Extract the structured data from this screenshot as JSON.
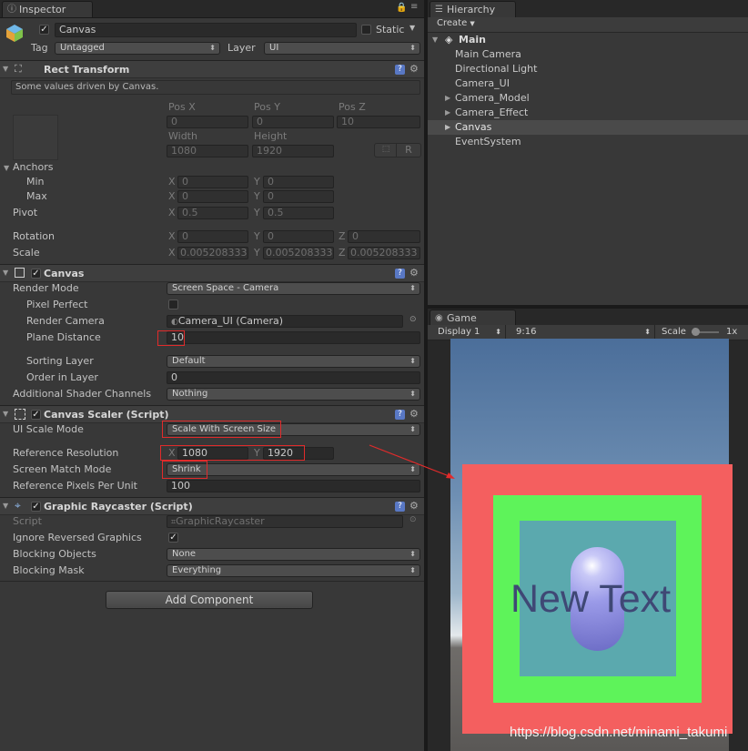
{
  "inspector": {
    "tab": "Inspector",
    "object_name": "Canvas",
    "static_label": "Static",
    "tag_label": "Tag",
    "tag_value": "Untagged",
    "layer_label": "Layer",
    "layer_value": "UI"
  },
  "rect_transform": {
    "title": "Rect Transform",
    "driven_note": "Some values driven by Canvas.",
    "pos_x_label": "Pos X",
    "pos_y_label": "Pos Y",
    "pos_z_label": "Pos Z",
    "pos_x": "0",
    "pos_y": "0",
    "pos_z": "10",
    "width_label": "Width",
    "height_label": "Height",
    "width": "1080",
    "height": "1920",
    "r_button": "R",
    "anchors_label": "Anchors",
    "min_label": "Min",
    "max_label": "Max",
    "min_x": "0",
    "min_y": "0",
    "max_x": "0",
    "max_y": "0",
    "pivot_label": "Pivot",
    "pivot_x": "0.5",
    "pivot_y": "0.5",
    "rotation_label": "Rotation",
    "rot_x": "0",
    "rot_y": "0",
    "rot_z": "0",
    "scale_label": "Scale",
    "scale_x": "0.005208333",
    "scale_y": "0.005208333",
    "scale_z": "0.005208333",
    "axis_x": "X",
    "axis_y": "Y",
    "axis_z": "Z"
  },
  "canvas": {
    "title": "Canvas",
    "render_mode_label": "Render Mode",
    "render_mode": "Screen Space - Camera",
    "pixel_perfect_label": "Pixel Perfect",
    "render_camera_label": "Render Camera",
    "render_camera": "Camera_UI (Camera)",
    "plane_distance_label": "Plane Distance",
    "plane_distance": "10",
    "sorting_layer_label": "Sorting Layer",
    "sorting_layer": "Default",
    "order_label": "Order in Layer",
    "order": "0",
    "shader_channels_label": "Additional Shader Channels",
    "shader_channels": "Nothing"
  },
  "canvas_scaler": {
    "title": "Canvas Scaler (Script)",
    "ui_scale_mode_label": "UI Scale Mode",
    "ui_scale_mode": "Scale With Screen Size",
    "ref_res_label": "Reference Resolution",
    "ref_x": "1080",
    "ref_y": "1920",
    "match_mode_label": "Screen Match Mode",
    "match_mode": "Shrink",
    "ref_ppu_label": "Reference Pixels Per Unit",
    "ref_ppu": "100"
  },
  "raycaster": {
    "title": "Graphic Raycaster (Script)",
    "script_label": "Script",
    "script_value": "GraphicRaycaster",
    "ignore_reversed_label": "Ignore Reversed Graphics",
    "blocking_objects_label": "Blocking Objects",
    "blocking_objects": "None",
    "blocking_mask_label": "Blocking Mask",
    "blocking_mask": "Everything"
  },
  "add_component": "Add Component",
  "hierarchy": {
    "tab": "Hierarchy",
    "create": "Create",
    "scene": "Main",
    "items": [
      "Main Camera",
      "Directional Light",
      "Camera_UI",
      "Camera_Model",
      "Camera_Effect",
      "Canvas",
      "EventSystem"
    ]
  },
  "game": {
    "tab": "Game",
    "display": "Display 1",
    "aspect": "9:16",
    "scale_label": "Scale",
    "scale_value": "1x",
    "scene_text": "New Text"
  },
  "watermark": "https://blog.csdn.net/minami_takumi",
  "colors": {
    "highlight": "#e12b2b",
    "outer_panel": "#f45f5f",
    "middle_panel": "#5ef35a",
    "inner_panel": "#5ba9ae",
    "capsule": "#9a9ae8"
  }
}
